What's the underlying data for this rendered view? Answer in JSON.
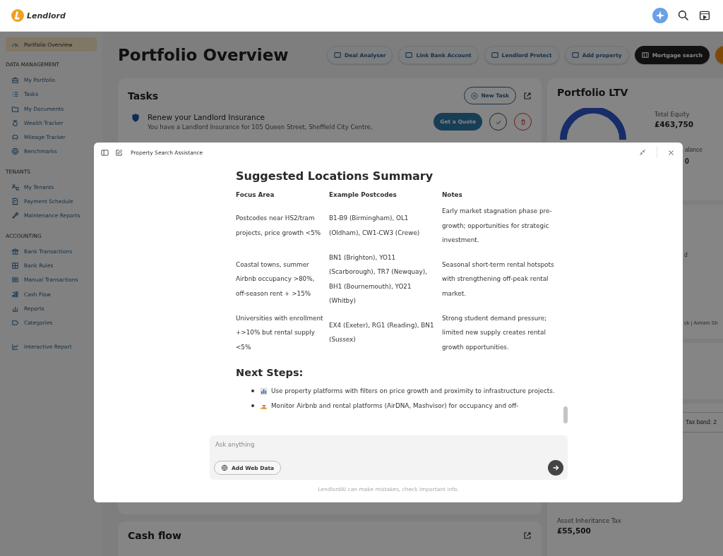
{
  "header": {
    "logo_text": "Lendlord"
  },
  "sidebar": {
    "sections": [
      {
        "items": [
          {
            "label": "Portfolio Overview",
            "selected": true
          }
        ]
      },
      {
        "title": "DATA MANAGEMENT",
        "items": [
          {
            "label": "My Portfolio",
            "selected": false
          },
          {
            "label": "Tasks",
            "selected": false
          },
          {
            "label": "My Documents",
            "selected": false
          },
          {
            "label": "Wealth Tracker",
            "selected": false
          },
          {
            "label": "Mileage Tracker",
            "selected": false
          },
          {
            "label": "Benchmarks",
            "selected": false
          }
        ]
      },
      {
        "title": "TENANTS",
        "items": [
          {
            "label": "My Tenants",
            "selected": false
          },
          {
            "label": "Payment Schedule",
            "selected": false
          },
          {
            "label": "Maintenance Reports",
            "selected": false
          }
        ]
      },
      {
        "title": "ACCOUNTING",
        "items": [
          {
            "label": "Bank Transactions",
            "selected": false
          },
          {
            "label": "Bank Rules",
            "selected": false
          },
          {
            "label": "Manual Transactions",
            "selected": false
          },
          {
            "label": "Cash Flow",
            "selected": false
          },
          {
            "label": "Reports",
            "selected": false
          },
          {
            "label": "Categories",
            "selected": false
          }
        ]
      },
      {
        "items": [
          {
            "label": "Interactive Report",
            "selected": false
          }
        ]
      }
    ]
  },
  "page_title": "Portfolio Overview",
  "actions": [
    {
      "label": "Deal Analyser",
      "kind": "outline"
    },
    {
      "label": "Link Bank Account",
      "kind": "outline"
    },
    {
      "label": "Lendlord Protect",
      "kind": "outline"
    },
    {
      "label": "Add property",
      "kind": "outline"
    },
    {
      "label": "Mortgage search",
      "kind": "dark"
    },
    {
      "kind": "accent"
    }
  ],
  "tasks": {
    "title": "Tasks",
    "new_task": "New Task",
    "items": [
      {
        "title": "Renew your Landlord Insurance",
        "description": "You have a Landlord Insurance for 105 Queen Street, Sheffield City Centre,",
        "quote": "Get a Quote"
      }
    ]
  },
  "portfolio_ltv": {
    "title": "Portfolio LTV",
    "total_equity_label": "Total Equity",
    "total_equity_value": "£463,750",
    "partial_label": "alance",
    "partial_value": "0"
  },
  "card_2": {
    "partial_label": "d",
    "partial_text": "ck | Aviram Sh"
  },
  "tax_band": {
    "partial_text": "Tax band: 2"
  },
  "asset_inheritance_tax": {
    "label": "Asset Inheritance Tax",
    "value": "£55,500"
  },
  "cash_flow": {
    "title": "Cash flow"
  },
  "assistant": {
    "title": "Property Search Assistance",
    "heading": "Suggested Locations Summary",
    "table": {
      "columns": [
        "Focus Area",
        "Example Postcodes",
        "Notes"
      ],
      "rows": [
        [
          "Postcodes near HS2/tram projects, price growth <5%",
          "B1-B9 (Birmingham), OL1 (Oldham), CW1-CW3 (Crewe)",
          "Early market stagnation phase pre-growth; opportunities for strategic investment."
        ],
        [
          "Coastal towns, summer Airbnb occupancy >80%, off-season rent + >15%",
          "BN1 (Brighton), YO11 (Scarborough), TR7 (Newquay), BH1 (Bournemouth), YO21 (Whitby)",
          "Seasonal short-term rental hotspots with strengthening off-peak rental market."
        ],
        [
          "Universities with enrollment +>10% but rental supply <5%",
          "EX4 (Exeter), RG1 (Reading), BN1 (Sussex)",
          "Strong student demand pressure; limited new supply creates rental growth opportunities."
        ]
      ]
    },
    "next_steps_heading": "Next Steps:",
    "next_steps": [
      "Use property platforms with filters on price growth and proximity to infrastructure projects.",
      "Monitor Airbnb and rental platforms (AirDNA, Mashvisor) for occupancy and off-"
    ],
    "input_placeholder": "Ask anything",
    "web_data_button": "Add Web Data",
    "disclaimer": "LendlordAI can make mistakes, check important info."
  }
}
